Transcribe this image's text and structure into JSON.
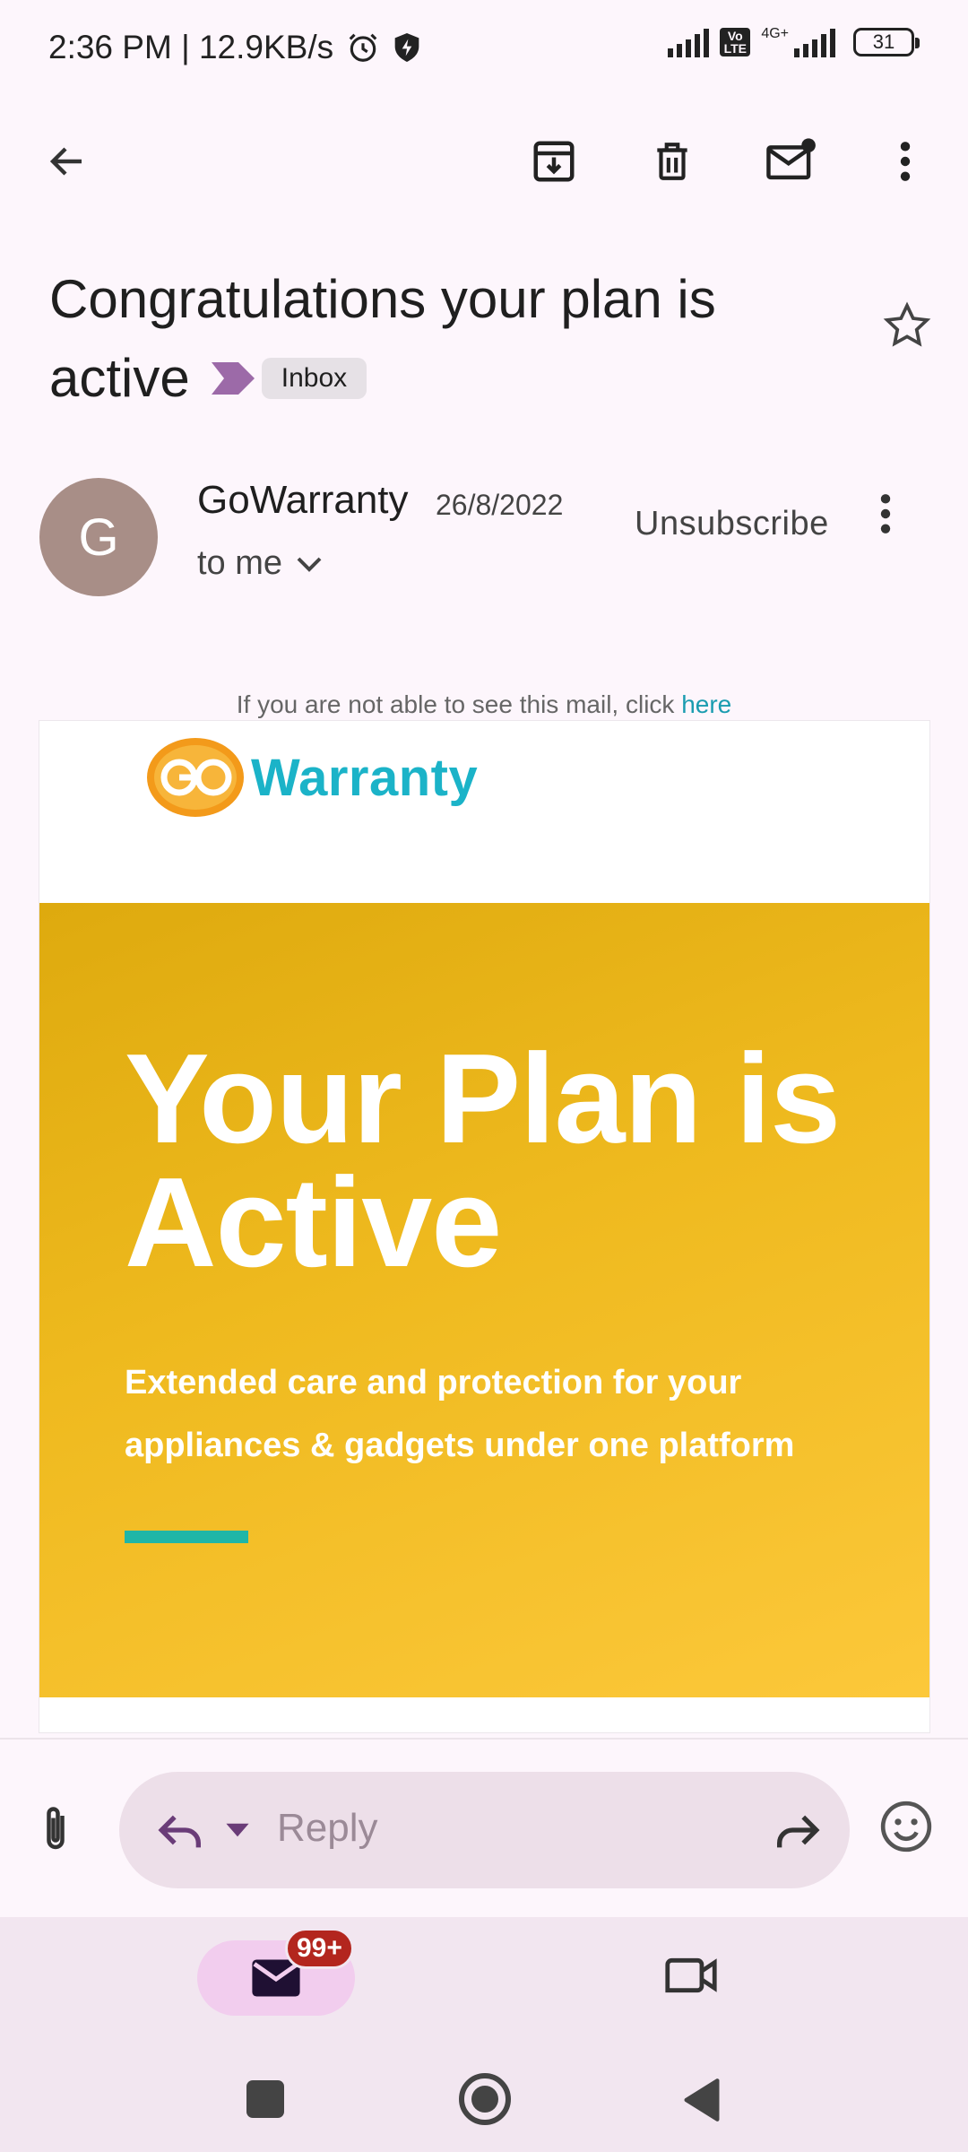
{
  "status_bar": {
    "time_speed": "2:36 PM | 12.9KB/s",
    "network_label": "4G+",
    "volte": "Vo LTE",
    "battery": "31"
  },
  "app_bar": {
    "icons": [
      "back-arrow-icon",
      "archive-icon",
      "delete-icon",
      "mark-unread-icon",
      "more-vert-icon"
    ]
  },
  "email": {
    "subject_line1": "Congratulations your plan is",
    "subject_line2": "active",
    "label_chip": "Inbox",
    "sender_initial": "G",
    "sender_name": "GoWarranty",
    "date": "26/8/2022",
    "recipient": "to me",
    "unsubscribe": "Unsubscribe"
  },
  "body": {
    "cant_see_text": "If you are not able to see this mail, click ",
    "cant_see_link": "here",
    "logo_text": "Warranty",
    "hero_line1": "Your Plan is",
    "hero_line2": "Active",
    "subtext": "Extended care and protection for your appliances & gadgets under one platform"
  },
  "reply_bar": {
    "placeholder": "Reply"
  },
  "bottom_nav": {
    "mail_badge": "99+"
  },
  "colors": {
    "accent_teal": "#1fb6a7",
    "banner_yellow": "#efba1f",
    "label_purple": "#9c6aa8",
    "badge_red": "#b3261e"
  }
}
